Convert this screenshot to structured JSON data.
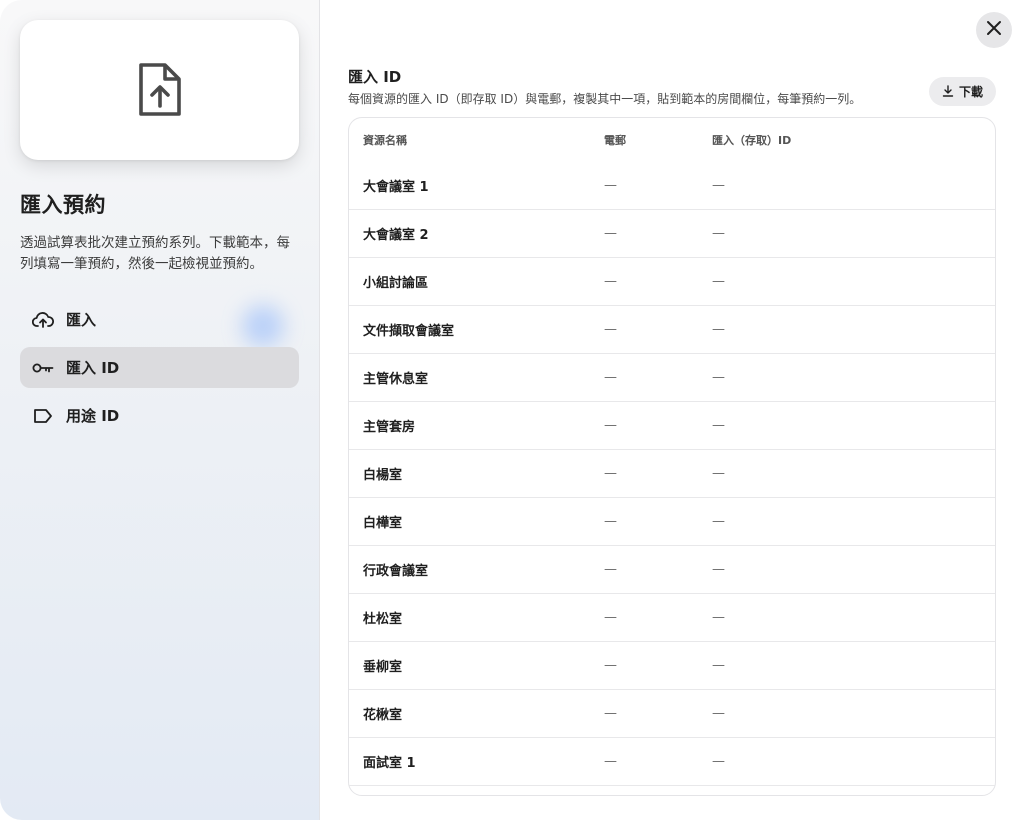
{
  "sidebar": {
    "title": "匯入預約",
    "description": "透過試算表批次建立預約系列。下載範本，每列填寫一筆預約，然後一起檢視並預約。",
    "nav": [
      {
        "label": "匯入",
        "icon": "cloud-upload-icon",
        "active": false
      },
      {
        "label": "匯入 ID",
        "icon": "key-icon",
        "active": true
      },
      {
        "label": "用途 ID",
        "icon": "tag-icon",
        "active": false
      }
    ]
  },
  "main": {
    "section_title": "匯入 ID",
    "section_desc": "每個資源的匯入 ID（即存取 ID）與電郵，複製其中一項，貼到範本的房間欄位，每筆預約一列。",
    "download_label": "下載",
    "table": {
      "headers": {
        "name": "資源名稱",
        "email": "電郵",
        "id": "匯入（存取）ID"
      },
      "rows": [
        {
          "name": "大會議室 1",
          "email": "—",
          "id": "—"
        },
        {
          "name": "大會議室 2",
          "email": "—",
          "id": "—"
        },
        {
          "name": "小組討論區",
          "email": "—",
          "id": "—"
        },
        {
          "name": "文件擷取會議室",
          "email": "—",
          "id": "—"
        },
        {
          "name": "主管休息室",
          "email": "—",
          "id": "—"
        },
        {
          "name": "主管套房",
          "email": "—",
          "id": "—"
        },
        {
          "name": "白楊室",
          "email": "—",
          "id": "—"
        },
        {
          "name": "白樺室",
          "email": "—",
          "id": "—"
        },
        {
          "name": "行政會議室",
          "email": "—",
          "id": "—"
        },
        {
          "name": "杜松室",
          "email": "—",
          "id": "—"
        },
        {
          "name": "垂柳室",
          "email": "—",
          "id": "—"
        },
        {
          "name": "花楸室",
          "email": "—",
          "id": "—"
        },
        {
          "name": "面試室 1",
          "email": "—",
          "id": "—"
        }
      ]
    }
  },
  "colors": {
    "active_nav_bg": "#dbdbde",
    "accent_blue": "#3b82f6"
  }
}
